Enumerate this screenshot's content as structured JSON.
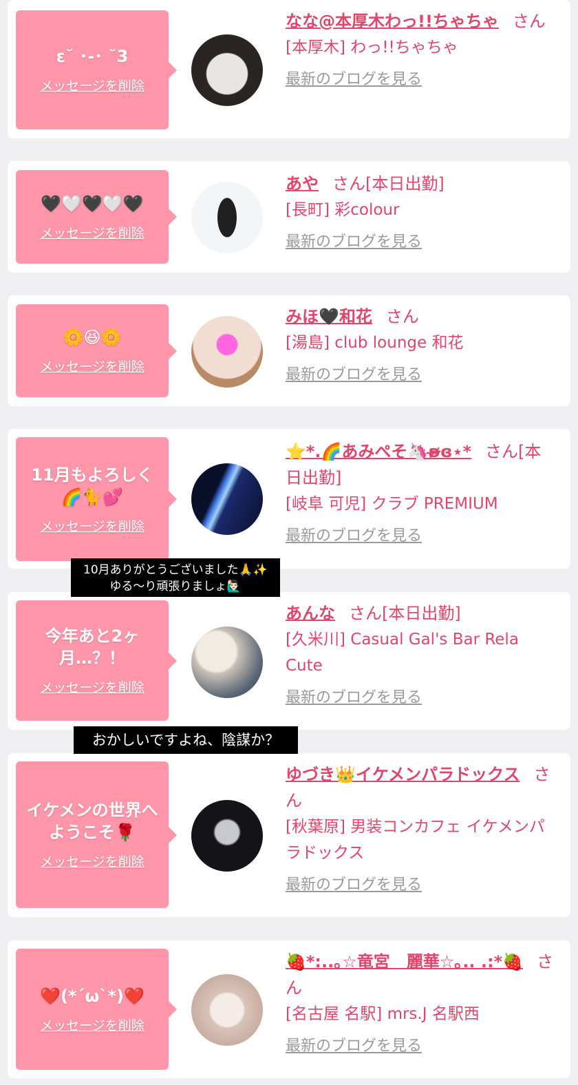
{
  "delete_label": "メッセージを削除",
  "blog_label": "最新のブログを見る",
  "san_label": "さん",
  "entries": [
    {
      "message": "ε˘ ･-･ ˘3",
      "name": "なな@本厚木わっ!!ちゃちゃ",
      "status": "",
      "shop": "[本厚木] わっ!!ちゃちゃ",
      "avatar_colors": [
        "#e8e6e4",
        "#2a2523"
      ]
    },
    {
      "message": "🖤🤍🖤🤍🖤",
      "name": "あや",
      "status": "[本日出勤]",
      "shop": "[長町] 彩colour",
      "avatar_colors": [
        "#f3f5f7",
        "#202020"
      ]
    },
    {
      "message": "🌼😆🌼",
      "name": "みほ🖤和花",
      "status": "",
      "shop": "[湯島] club lounge 和花",
      "avatar_colors": [
        "#f2ddd2",
        "#b88a66"
      ]
    },
    {
      "message": "11月もよろしく🌈🐈💕",
      "name": "⭐*.🌈あみぺそ🦄ʚ̴̶̷̷ɞ⋆*",
      "status": "[本日出勤]",
      "shop": "[岐阜 可児] クラブ PREMIUM",
      "avatar_colors": [
        "#1a2a6c",
        "#0a0f2a"
      ]
    },
    {
      "message": "今年あと2ヶ月…？！",
      "name": "あんな",
      "status": "[本日出勤]",
      "shop": "[久米川] Casual Gal's Bar Rela Cute",
      "avatar_colors": [
        "#f2ebe4",
        "#5a6575"
      ]
    },
    {
      "message": "イケメンの世界へようこそ🌹",
      "name": "ゆづき👑イケメンパラドックス",
      "status": "",
      "shop": "[秋葉原] 男装コンカフェ イケメンパラドックス",
      "avatar_colors": [
        "#dcdde3",
        "#141418"
      ]
    },
    {
      "message": "❤️(*´ω`*)❤️",
      "name": "🍓*:..｡☆竜宮　麗華☆｡.. .:*🍓",
      "status": "",
      "shop": "[名古屋 名駅] mrs.J 名駅西",
      "avatar_colors": [
        "#f0e4df",
        "#c9aea2"
      ]
    }
  ],
  "captions": [
    {
      "text": "10月ありがとうございました🙏✨\nゆる〜り頑張りましょ🙋🏻‍♂️"
    },
    {
      "text": "おかしいですよね、陰謀か？"
    }
  ]
}
